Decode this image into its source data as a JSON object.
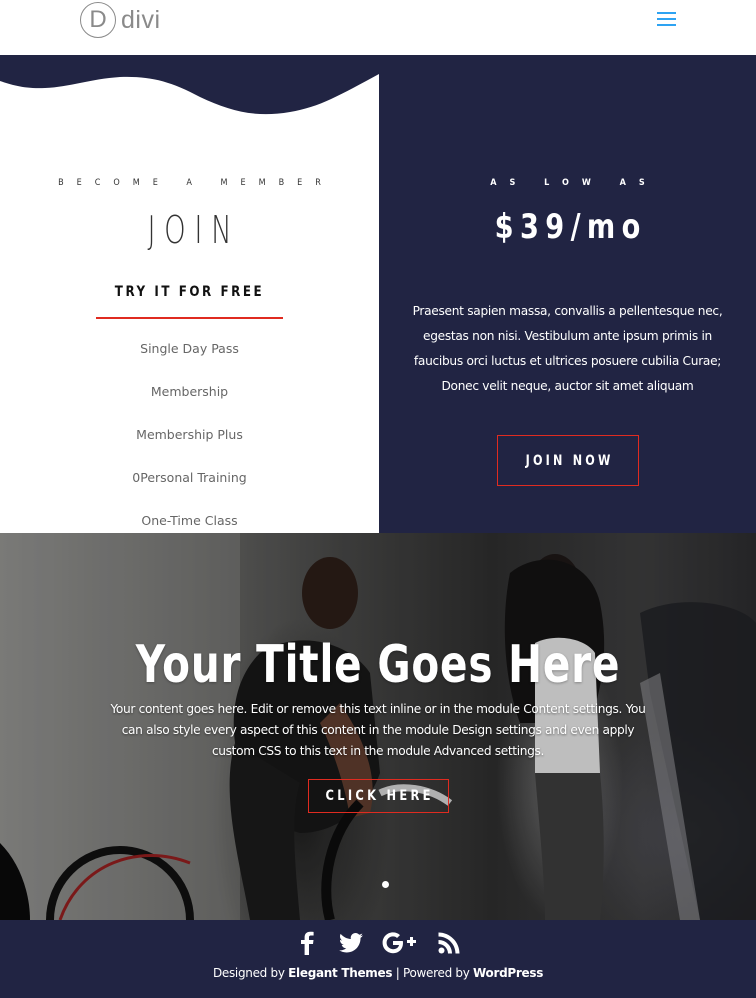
{
  "header": {
    "logo_letter": "D",
    "logo_text": "divi",
    "menu_icon": "hamburger-menu-icon",
    "accent_color": "#2ea3f2"
  },
  "membership": {
    "left": {
      "eyebrow": "Become a Member",
      "title": "JOIN",
      "subtitle": "TRY IT FOR FREE",
      "plans": [
        "Single Day Pass",
        "Membership",
        "Membership Plus",
        "0Personal Training",
        "One-Time Class"
      ]
    },
    "right": {
      "eyebrow": "As low as",
      "price": "$39/mo",
      "description": "Praesent sapien massa, convallis a pellentesque nec, egestas non nisi. Vestibulum ante ipsum primis in faucibus orci luctus et ultrices posuere cubilia Curae; Donec velit neque, auctor sit amet aliquam",
      "button_label": "JOIN NOW"
    },
    "colors": {
      "navy": "#212443",
      "red": "#e02b20"
    }
  },
  "hero": {
    "title": "Your Title Goes Here",
    "text": "Your content goes here. Edit or remove this text inline or in the module Content settings. You can also style every aspect of this content in the module Design settings and even apply custom CSS to this text in the module Advanced settings.",
    "button_label": "CLICK HERE",
    "slide_count": 1,
    "active_slide": 1
  },
  "footer": {
    "social": [
      {
        "name": "facebook-icon",
        "glyph": "f"
      },
      {
        "name": "twitter-icon",
        "glyph": "twitter"
      },
      {
        "name": "google-plus-icon",
        "glyph": "G+"
      },
      {
        "name": "rss-icon",
        "glyph": "rss"
      }
    ],
    "designed_by_prefix": "Designed by",
    "designed_by_link": "Elegant Themes",
    "separator": "|",
    "powered_by_prefix": "Powered by",
    "powered_by_link": "WordPress"
  }
}
